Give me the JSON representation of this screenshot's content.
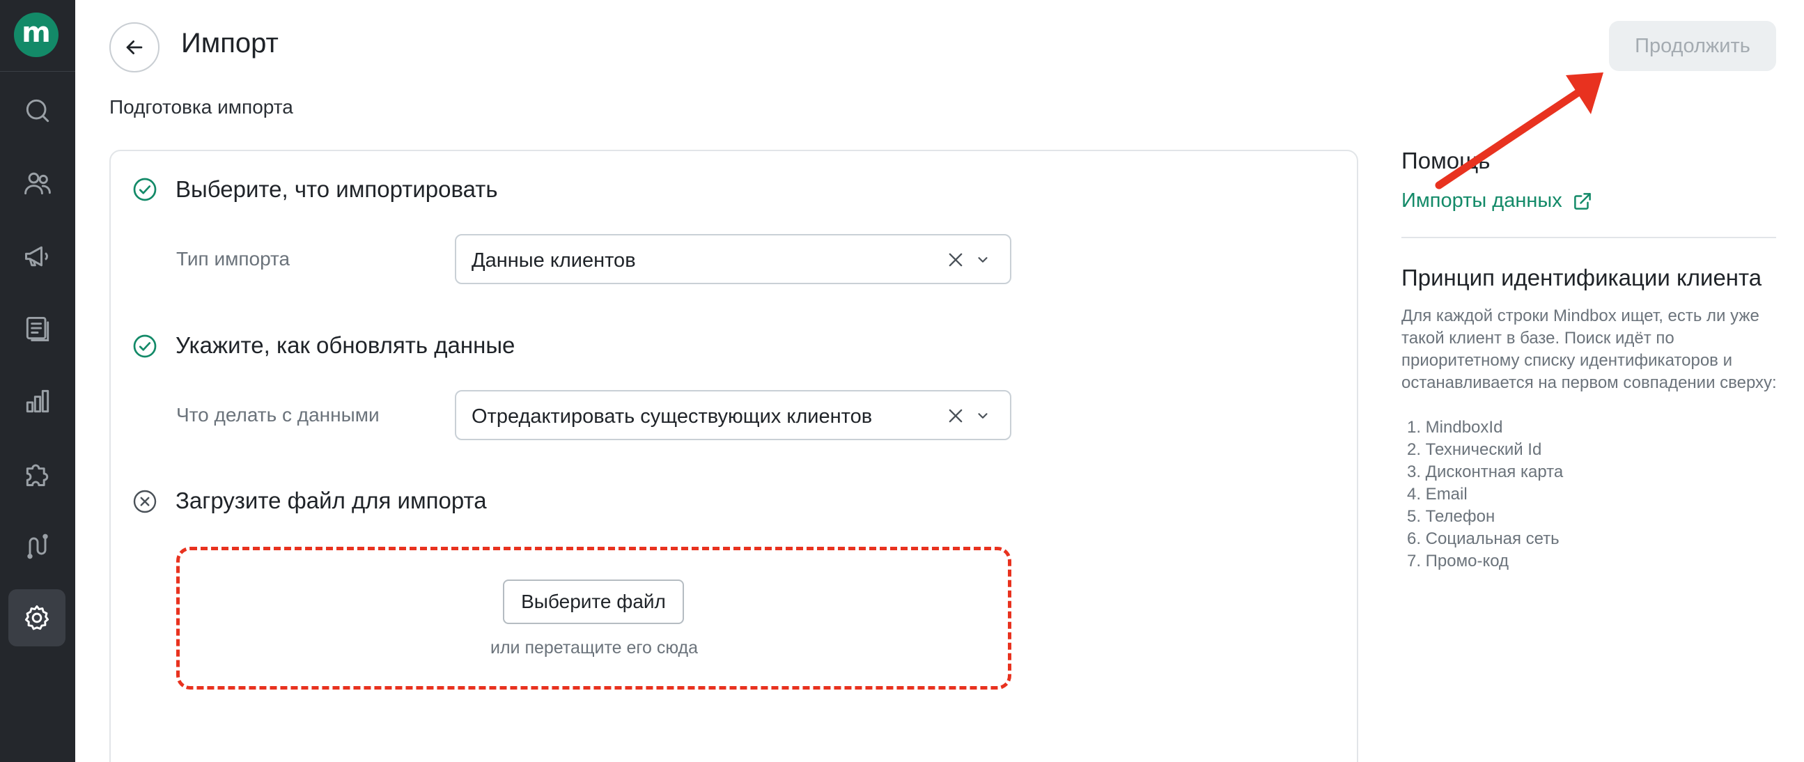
{
  "app": {
    "logo_text": "m",
    "accent": "#138a68",
    "sidebar_bg": "#24272c"
  },
  "sidebar": {
    "items": [
      {
        "icon": "search-icon"
      },
      {
        "icon": "users-icon"
      },
      {
        "icon": "megaphone-icon"
      },
      {
        "icon": "content-icon"
      },
      {
        "icon": "analytics-icon"
      },
      {
        "icon": "puzzle-icon"
      },
      {
        "icon": "journey-icon"
      },
      {
        "icon": "settings-icon",
        "active": true
      }
    ]
  },
  "header": {
    "title": "Импорт",
    "continue_label": "Продолжить",
    "subtitle": "Подготовка импорта"
  },
  "steps": [
    {
      "title": "Выберите, что импортировать",
      "status": "done",
      "field_label": "Тип импорта",
      "value": "Данные клиентов"
    },
    {
      "title": "Укажите, как обновлять данные",
      "status": "done",
      "field_label": "Что делать с данными",
      "value": "Отредактировать существующих клиентов"
    },
    {
      "title": "Загрузите файл для импорта",
      "status": "error"
    }
  ],
  "upload": {
    "button_label": "Выберите файл",
    "hint": "или перетащите его сюда"
  },
  "help": {
    "title": "Помощь",
    "link_label": "Импорты данных",
    "principle_title": "Принцип идентификации клиента",
    "principle_text": "Для каждой строки Mindbox ищет, есть ли уже такой клиент в базе. Поиск идёт по приоритетному списку идентификаторов и останавливается на первом совпадении сверху:",
    "identifiers": [
      "1. MindboxId",
      "2. Технический Id",
      "3. Дисконтная карта",
      "4. Email",
      "5. Телефон",
      "6. Социальная сеть",
      "7. Промо-код"
    ]
  },
  "colors": {
    "annotation": "#e8321f",
    "success": "#138a68"
  }
}
